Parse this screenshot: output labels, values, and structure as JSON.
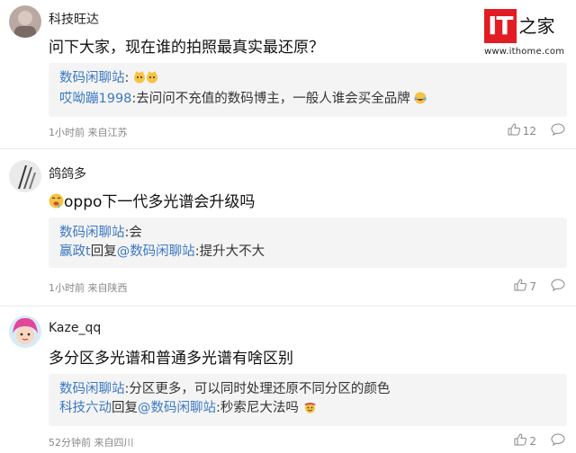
{
  "header": {
    "logo_it": "IT",
    "logo_zhi": "之家",
    "logo_url": "www.ithome.com"
  },
  "comments": [
    {
      "username": "科技旺达",
      "text": "问下大家，现在谁的拍照最真实最还原？",
      "replies": [
        {
          "user": "数码闲聊站",
          "joiner": "",
          "target": "",
          "body": ":"
        },
        {
          "user": "哎呦蹦1998",
          "joiner": "",
          "target": "",
          "body": ":去问问不充值的数码博主，一般人谁会买全品牌"
        }
      ],
      "meta": "1小时前 来自江苏",
      "likes": "12"
    },
    {
      "username": "鸽鸽多",
      "text": "oppo下一代多光谱会升级吗",
      "replies": [
        {
          "user": "数码闲聊站",
          "joiner": "",
          "target": "",
          "body": ":会"
        },
        {
          "user": "赢政t",
          "joiner": "回复",
          "target": "@数码闲聊站",
          "body": ":提升大不大"
        }
      ],
      "meta": "1小时前 来自陕西",
      "likes": "7"
    },
    {
      "username": "Kaze_qq",
      "text": "多分区多光谱和普通多光谱有啥区别",
      "replies": [
        {
          "user": "数码闲聊站",
          "joiner": "",
          "target": "",
          "body": ":分区更多，可以同时处理还原不同分区的颜色"
        },
        {
          "user": "科技六动",
          "joiner": "回复",
          "target": "@数码闲聊站",
          "body": ":秒索尼大法吗"
        }
      ],
      "meta": "52分钟前 来自四川",
      "likes": "2"
    }
  ]
}
